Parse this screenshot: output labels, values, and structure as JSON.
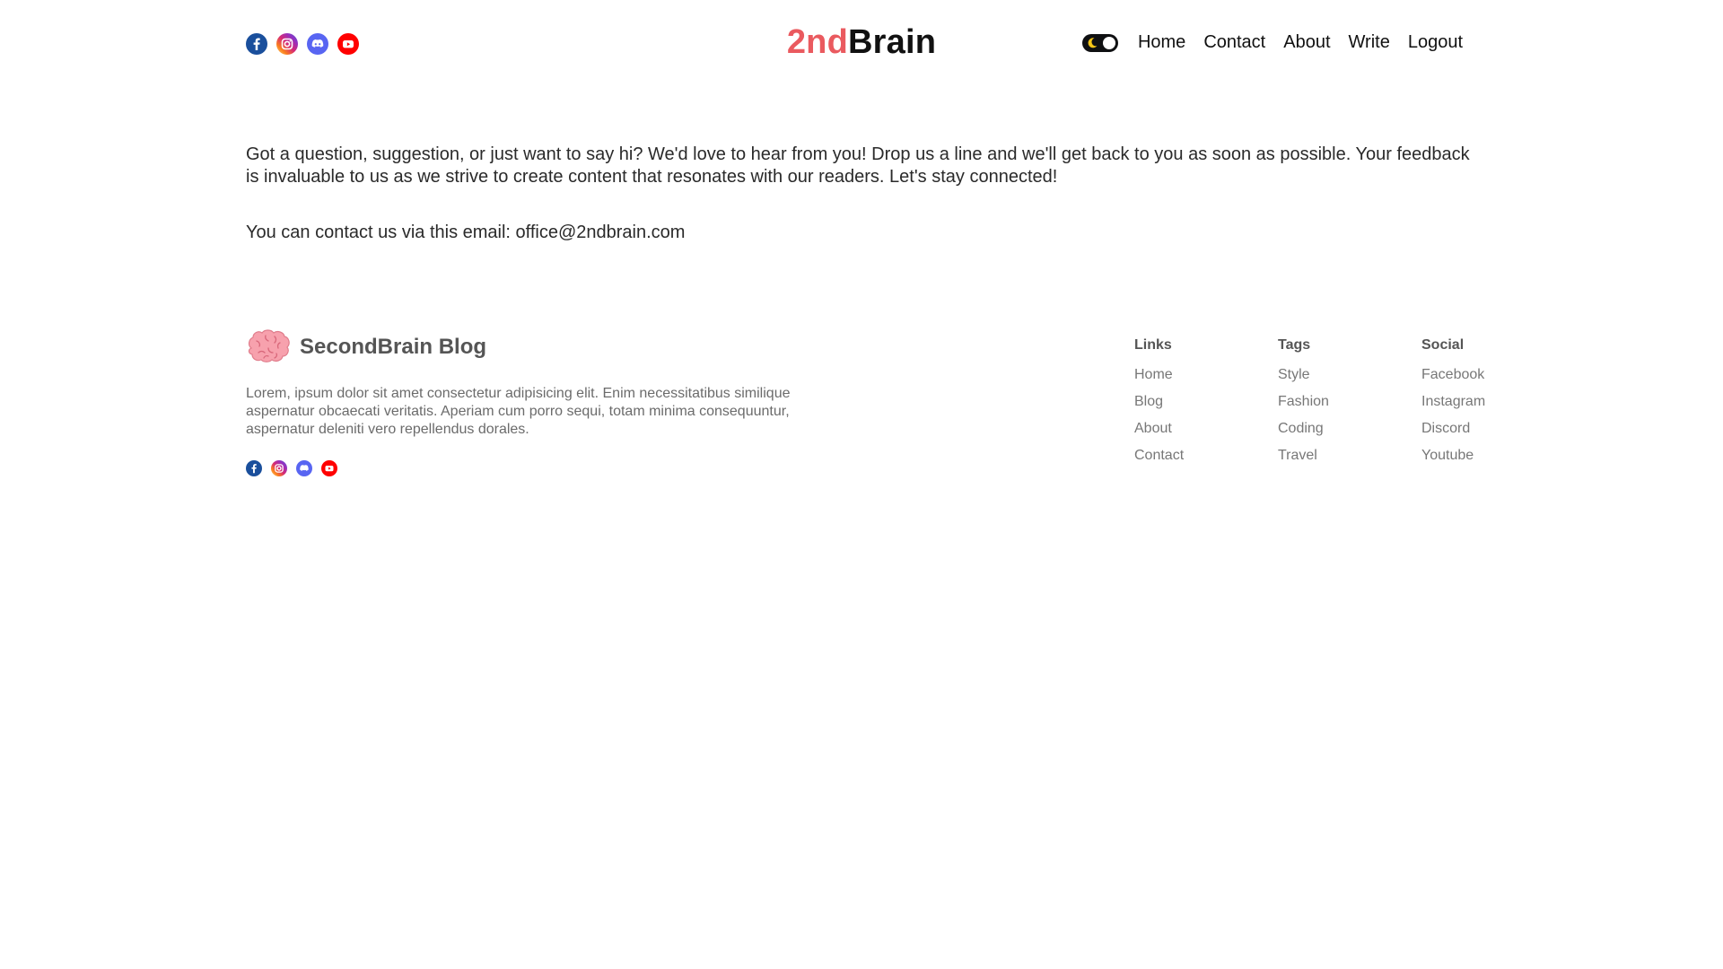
{
  "header": {
    "social_icons": [
      "facebook-icon",
      "instagram-icon",
      "discord-icon",
      "youtube-icon"
    ],
    "logo_part1": "2nd",
    "logo_part2": "Brain",
    "theme_toggle_icon": "moon-icon",
    "nav": {
      "home": "Home",
      "contact": "Contact",
      "about": "About",
      "write": "Write",
      "logout": "Logout"
    }
  },
  "main": {
    "intro": "Got a question, suggestion, or just want to say hi? We'd love to hear from you! Drop us a line and we'll get back to you as soon as possible. Your feedback is invaluable to us as we strive to create content that resonates with our readers. Let's stay connected!",
    "email_line": "You can contact us via this email: office@2ndbrain.com"
  },
  "footer": {
    "brand_icon": "brain-icon",
    "brand_name": "SecondBrain Blog",
    "description": "Lorem, ipsum dolor sit amet consectetur adipisicing elit. Enim necessitatibus similique aspernatur obcaecati veritatis. Aperiam cum porro sequi, totam minima consequuntur, aspernatur deleniti vero repellendus dorales.",
    "social_icons": [
      "facebook-icon",
      "instagram-icon",
      "discord-icon",
      "youtube-icon"
    ],
    "links": {
      "title": "Links",
      "items": [
        "Home",
        "Blog",
        "About",
        "Contact"
      ]
    },
    "tags": {
      "title": "Tags",
      "items": [
        "Style",
        "Fashion",
        "Coding",
        "Travel"
      ]
    },
    "social": {
      "title": "Social",
      "items": [
        "Facebook",
        "Instagram",
        "Discord",
        "Youtube"
      ]
    }
  },
  "colors": {
    "logo_accent": "#ea5a5f",
    "facebook": "#1a4f9c",
    "instagram": "#d62976",
    "discord": "#5865f2",
    "youtube": "#ff0000",
    "toggle_bg": "#0f1012",
    "moon": "#f5c518"
  }
}
